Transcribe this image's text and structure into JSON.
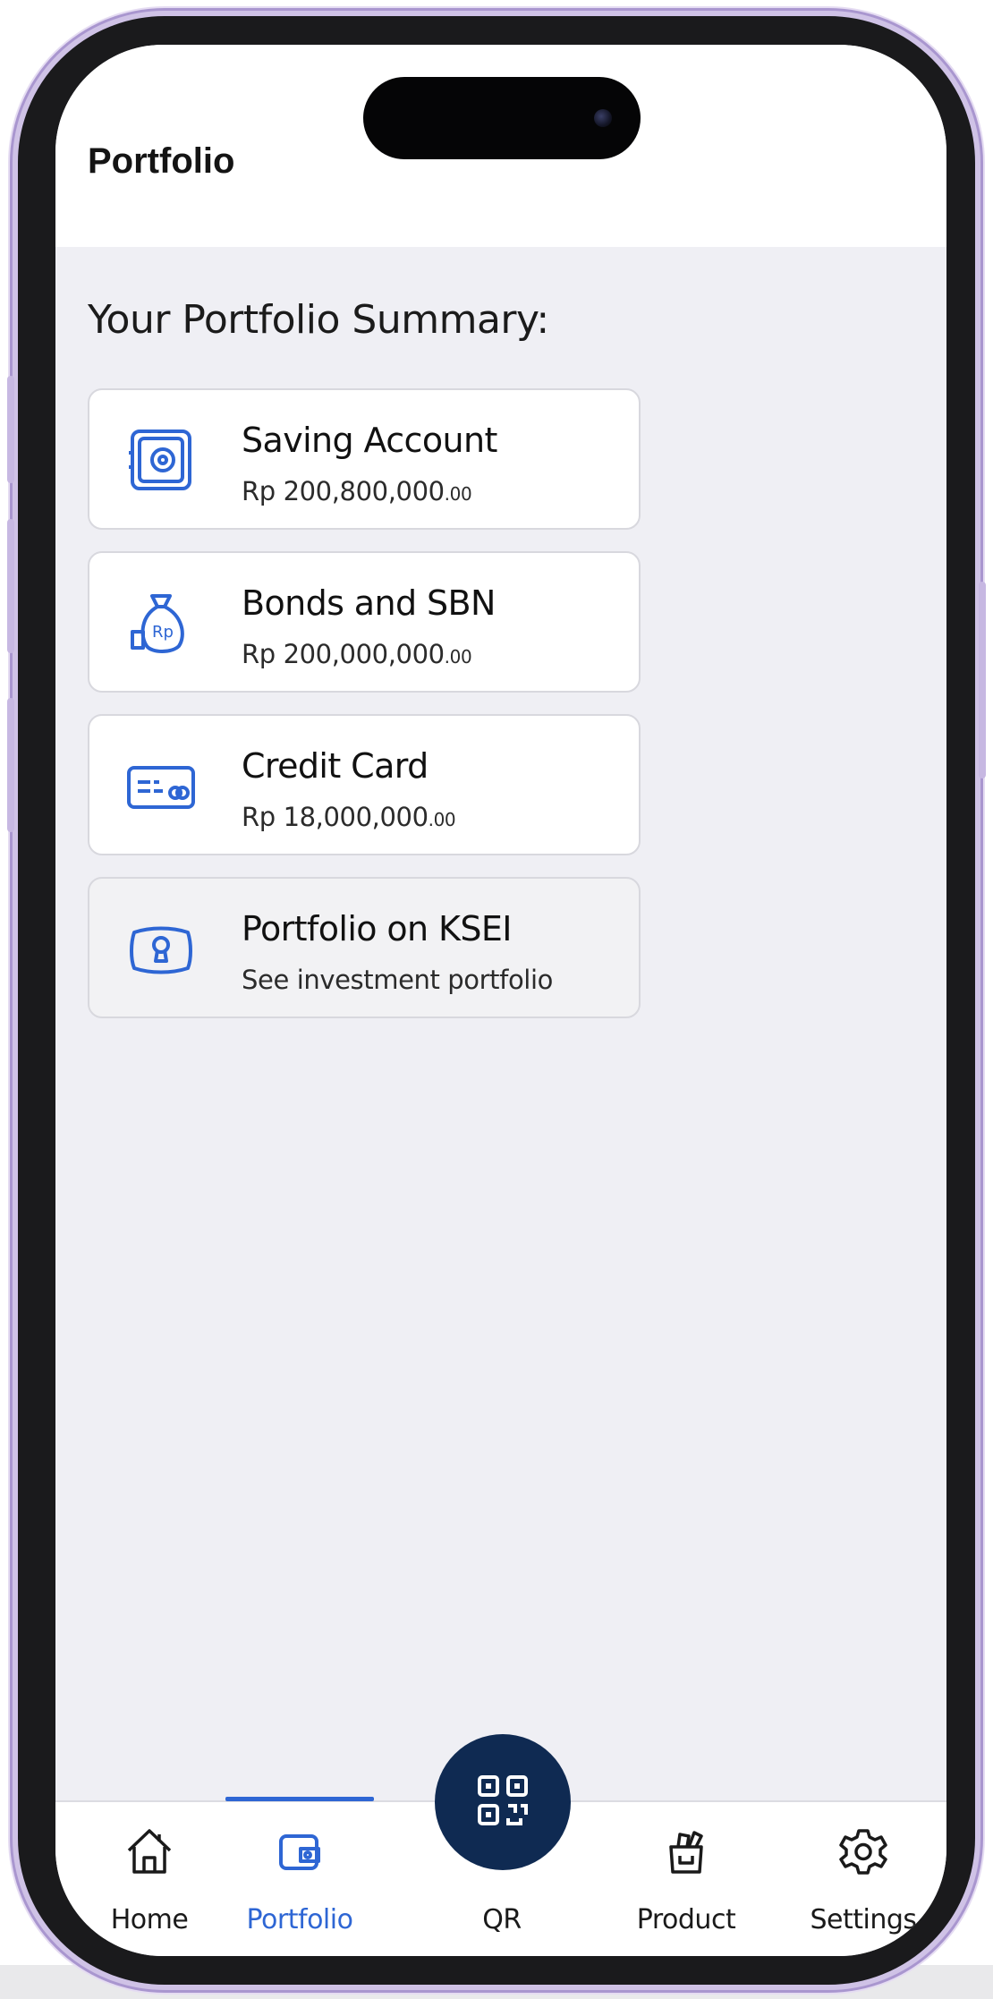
{
  "header": {
    "title": "Portfolio"
  },
  "summary": {
    "heading": "Your Portfolio Summary:",
    "items": [
      {
        "title": "Saving Account",
        "amount": "Rp 200,800,000",
        "cents": ".00",
        "icon": "safe-icon"
      },
      {
        "title": "Bonds and SBN",
        "amount": "Rp 200,000,000",
        "cents": ".00",
        "icon": "money-bag-icon"
      },
      {
        "title": "Credit Card",
        "amount": "Rp 18,000,000",
        "cents": ".00",
        "icon": "credit-card-icon"
      },
      {
        "title": "Portfolio on KSEI",
        "subtitle": "See investment portfolio",
        "icon": "keyhole-icon"
      }
    ]
  },
  "tabbar": {
    "active": "Portfolio",
    "tabs": [
      {
        "label": "Home",
        "icon": "home-icon"
      },
      {
        "label": "Portfolio",
        "icon": "wallet-icon"
      },
      {
        "label": "QR",
        "icon": "qr-code-icon"
      },
      {
        "label": "Product",
        "icon": "product-icon"
      },
      {
        "label": "Settings",
        "icon": "gear-icon"
      }
    ]
  },
  "colors": {
    "accent": "#2e66d4",
    "qr_button": "#0f2a52",
    "background": "#efeff4"
  }
}
